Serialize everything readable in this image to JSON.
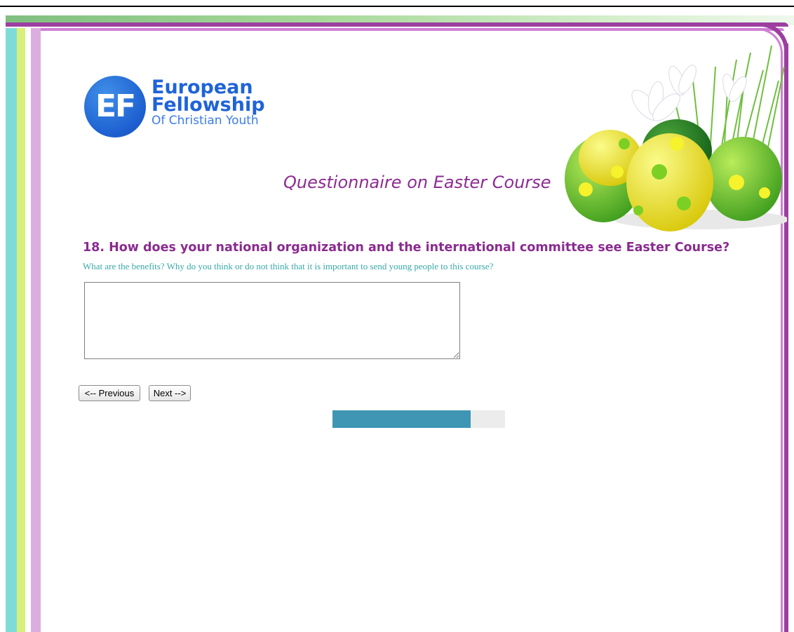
{
  "logo": {
    "monogram": "EF",
    "line1": "European",
    "line2": "Fellowship",
    "line3": "Of Christian Youth"
  },
  "page_title": "Questionnaire on Easter Course",
  "question": {
    "text": "18. How does your national organization and the international committee see Easter Course?",
    "help": "What are the benefits? Why do you think or do not think that it is important to send young people to this course?",
    "answer_value": ""
  },
  "navigation": {
    "previous_label": "<-- Previous",
    "next_label": "Next -->"
  },
  "progress": {
    "fraction": 0.8
  },
  "colors": {
    "title": "#8d2b93",
    "help_text": "#37a8a8",
    "progress_fill": "#3e96b4",
    "progress_track": "#ececec",
    "frame_purple": "#9c3fa0"
  }
}
